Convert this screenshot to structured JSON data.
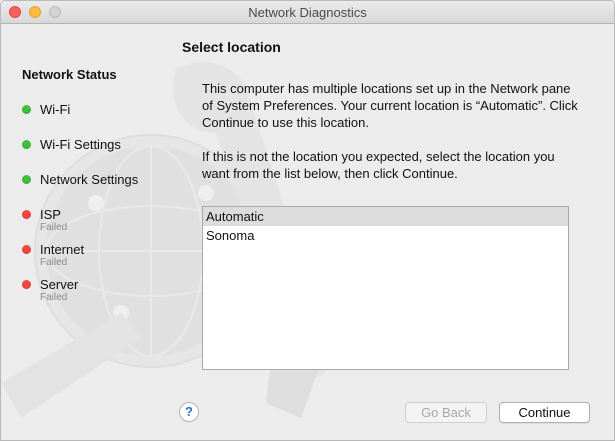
{
  "window": {
    "title": "Network Diagnostics"
  },
  "heading": "Select location",
  "sidebar": {
    "title": "Network Status",
    "items": [
      {
        "label": "Wi-Fi",
        "status": "ok",
        "sub": ""
      },
      {
        "label": "Wi-Fi Settings",
        "status": "ok",
        "sub": ""
      },
      {
        "label": "Network Settings",
        "status": "ok",
        "sub": ""
      },
      {
        "label": "ISP",
        "status": "failed",
        "sub": "Failed"
      },
      {
        "label": "Internet",
        "status": "failed",
        "sub": "Failed"
      },
      {
        "label": "Server",
        "status": "failed",
        "sub": "Failed"
      }
    ]
  },
  "main": {
    "paragraph1": "This computer has multiple locations set up in the Network pane of System Preferences. Your current location is “Automatic”. Click Continue to use this location.",
    "paragraph2": "If this is not the location you expected, select the location you want from the list below, then click Continue.",
    "locations": [
      "Automatic",
      "Sonoma"
    ],
    "selected_location": "Automatic"
  },
  "buttons": {
    "help": "?",
    "go_back": "Go Back",
    "continue": "Continue"
  },
  "colors": {
    "status_ok": "#3fbf3f",
    "status_failed": "#f2453d",
    "help_accent": "#2b6fd6"
  }
}
